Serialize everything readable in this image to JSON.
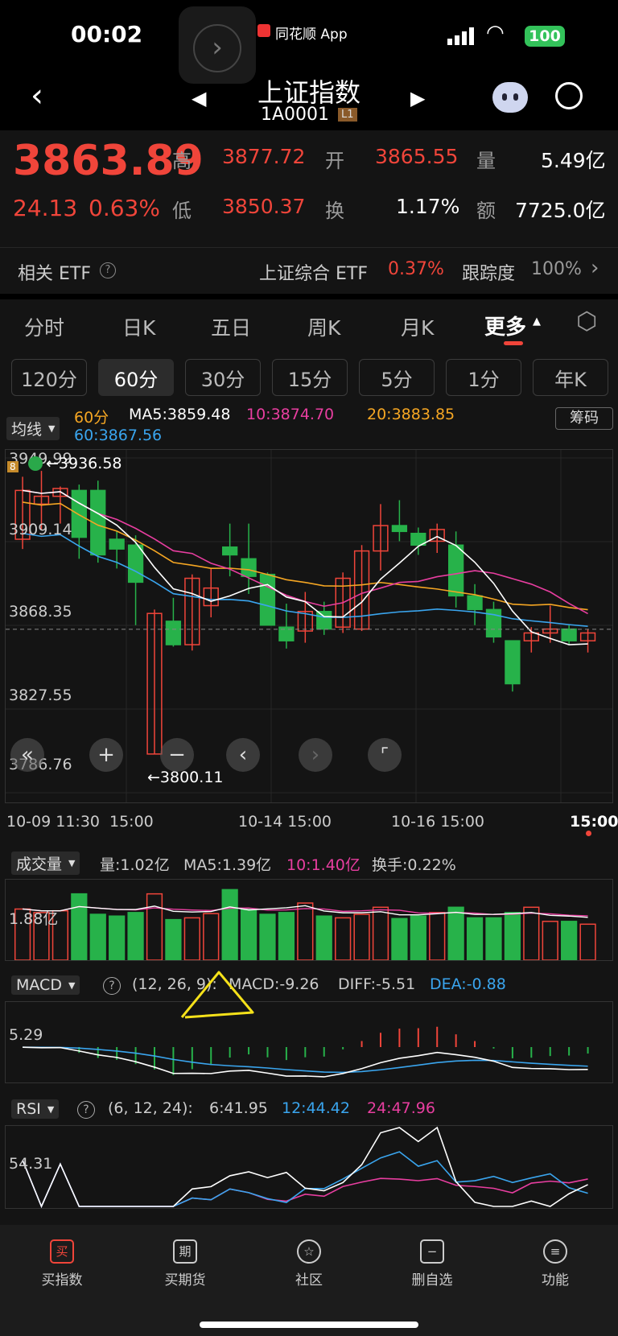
{
  "status": {
    "time": "00:02",
    "app_label": "同花顺 App",
    "battery": "100"
  },
  "header": {
    "title": "上证指数",
    "code": "1A0001",
    "level": "L1"
  },
  "quote": {
    "price": "3863.89",
    "change": "24.13",
    "change_pct": "0.63%",
    "high_label": "高",
    "high": "3877.72",
    "open_label": "开",
    "open": "3865.55",
    "vol_label": "量",
    "vol": "5.49亿",
    "low_label": "低",
    "low": "3850.37",
    "turnover_label": "换",
    "turnover": "1.17%",
    "amount_label": "额",
    "amount": "7725.0亿"
  },
  "etf": {
    "label": "相关 ETF",
    "name": "上证综合 ETF",
    "pct": "0.37%",
    "track_label": "跟踪度",
    "track": "100%"
  },
  "tabs": [
    "分时",
    "日K",
    "五日",
    "周K",
    "月K",
    "更多"
  ],
  "periods": [
    "120分",
    "60分",
    "30分",
    "15分",
    "5分",
    "1分",
    "年K"
  ],
  "main_chart": {
    "indicator": "均线",
    "chip_button": "筹码",
    "period": "60分",
    "ma5": "MA5:3859.48",
    "ma10": "10:3874.70",
    "ma20": "20:3883.85",
    "ma60": "60:3867.56",
    "y_ticks": [
      "3949.99",
      "3909.14",
      "3868.35",
      "3827.55",
      "3786.76"
    ],
    "max_label": "←3936.58",
    "min_label": "←3800.11",
    "badge": "8",
    "x_labels": [
      "10-09 11:30",
      "15:00",
      "10-14 15:00",
      "10-16 15:00",
      "15:00"
    ]
  },
  "volume": {
    "selector": "成交量",
    "vol": "量:1.02亿",
    "ma5": "MA5:1.39亿",
    "ma10": "10:1.40亿",
    "turnover": "换手:0.22%",
    "y_tick": "1.88亿"
  },
  "macd": {
    "selector": "MACD",
    "params": "(12, 26, 9):",
    "macd": "MACD:-9.26",
    "diff": "DIFF:-5.51",
    "dea": "DEA:-0.88",
    "y_tick": "5.29"
  },
  "rsi": {
    "selector": "RSI",
    "params": "(6, 12, 24):",
    "r6": "6:41.95",
    "r12": "12:44.42",
    "r24": "24:47.96",
    "y_tick": "54.31"
  },
  "nav": [
    {
      "icon": "买",
      "label": "买指数"
    },
    {
      "icon": "期",
      "label": "买期货"
    },
    {
      "icon": "☆",
      "label": "社区"
    },
    {
      "icon": "−",
      "label": "删自选"
    },
    {
      "icon": "≡",
      "label": "功能"
    }
  ],
  "colors": {
    "up": "#f0453a",
    "down": "#27b24a",
    "ma5": "#ffffff",
    "ma10": "#e83ea0",
    "ma20": "#f5a623",
    "ma60": "#3aa5ee"
  },
  "chart_data": {
    "type": "candlestick",
    "title": "上证指数 60分",
    "candles": [
      {
        "o": 3910,
        "c": 3935,
        "h": 3942,
        "l": 3905
      },
      {
        "o": 3928,
        "c": 3932,
        "h": 3945,
        "l": 3915
      },
      {
        "o": 3932,
        "c": 3936,
        "h": 3937,
        "l": 3918
      },
      {
        "o": 3935,
        "c": 3911,
        "h": 3938,
        "l": 3900
      },
      {
        "o": 3935,
        "c": 3902,
        "h": 3940,
        "l": 3898
      },
      {
        "o": 3910,
        "c": 3905,
        "h": 3914,
        "l": 3895
      },
      {
        "o": 3907,
        "c": 3888,
        "h": 3912,
        "l": 3866
      },
      {
        "o": 3800,
        "c": 3872,
        "h": 3874,
        "l": 3800
      },
      {
        "o": 3868,
        "c": 3856,
        "h": 3880,
        "l": 3855
      },
      {
        "o": 3856,
        "c": 3890,
        "h": 3892,
        "l": 3853
      },
      {
        "o": 3876,
        "c": 3885,
        "h": 3895,
        "l": 3870
      },
      {
        "o": 3906,
        "c": 3902,
        "h": 3918,
        "l": 3891
      },
      {
        "o": 3900,
        "c": 3891,
        "h": 3918,
        "l": 3882
      },
      {
        "o": 3892,
        "c": 3866,
        "h": 3893,
        "l": 3870
      },
      {
        "o": 3865,
        "c": 3858,
        "h": 3877,
        "l": 3854
      },
      {
        "o": 3863,
        "c": 3873,
        "h": 3883,
        "l": 3857
      },
      {
        "o": 3873,
        "c": 3864,
        "h": 3878,
        "l": 3861
      },
      {
        "o": 3865,
        "c": 3890,
        "h": 3893,
        "l": 3862
      },
      {
        "o": 3864,
        "c": 3904,
        "h": 3907,
        "l": 3863
      },
      {
        "o": 3904,
        "c": 3917,
        "h": 3928,
        "l": 3894
      },
      {
        "o": 3917,
        "c": 3914,
        "h": 3930,
        "l": 3909
      },
      {
        "o": 3913,
        "c": 3907,
        "h": 3916,
        "l": 3902
      },
      {
        "o": 3909,
        "c": 3915,
        "h": 3918,
        "l": 3903
      },
      {
        "o": 3907,
        "c": 3881,
        "h": 3914,
        "l": 3875
      },
      {
        "o": 3881,
        "c": 3874,
        "h": 3887,
        "l": 3866
      },
      {
        "o": 3874,
        "c": 3860,
        "h": 3878,
        "l": 3857
      },
      {
        "o": 3858,
        "c": 3836,
        "h": 3858,
        "l": 3832
      },
      {
        "o": 3858,
        "c": 3862,
        "h": 3865,
        "l": 3852
      },
      {
        "o": 3862,
        "c": 3864,
        "h": 3876,
        "l": 3857
      },
      {
        "o": 3864,
        "c": 3858,
        "h": 3866,
        "l": 3856
      },
      {
        "o": 3858,
        "c": 3862,
        "h": 3864,
        "l": 3852
      }
    ],
    "ylim": [
      3786.76,
      3949.99
    ],
    "volume": [
      1.45,
      1.35,
      1.4,
      1.88,
      1.3,
      1.25,
      1.35,
      1.88,
      1.15,
      1.2,
      1.32,
      2.0,
      1.45,
      1.3,
      1.35,
      1.62,
      1.25,
      1.2,
      1.3,
      1.5,
      1.18,
      1.25,
      1.35,
      1.5,
      1.2,
      1.2,
      1.35,
      1.5,
      1.1,
      1.1,
      1.02
    ]
  }
}
